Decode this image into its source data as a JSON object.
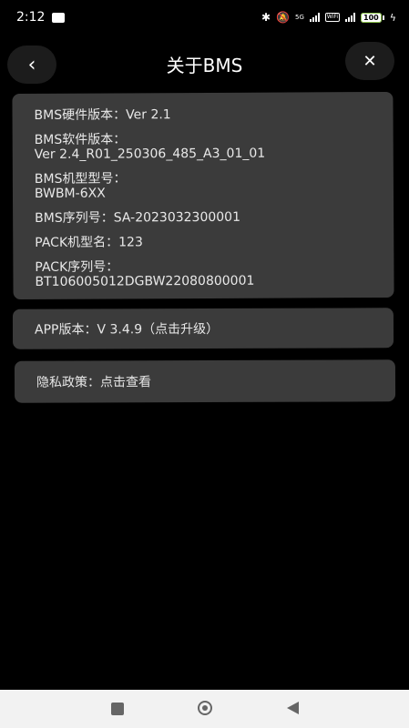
{
  "status_bar": {
    "time": "2:12",
    "net_label": "5G",
    "wifi_label": "WiFi",
    "battery": "100"
  },
  "header": {
    "title": "关于BMS",
    "back_icon": "chevron-left-icon",
    "close_icon": "close-icon"
  },
  "info": {
    "hw_version_label": "BMS硬件版本：",
    "hw_version_value": "Ver 2.1",
    "sw_version_label": "BMS软件版本：",
    "sw_version_value": "Ver 2.4_R01_250306_485_A3_01_01",
    "model_label": "BMS机型型号：",
    "model_value": "BWBM-6XX",
    "serial_label": "BMS序列号：",
    "serial_value": "SA-2023032300001",
    "pack_model_label": "PACK机型名：",
    "pack_model_value": "123",
    "pack_serial_label": "PACK序列号：",
    "pack_serial_value": "BT106005012DGBW22080800001"
  },
  "app": {
    "version_text": "APP版本：V 3.4.9（点击升级）"
  },
  "privacy": {
    "text": "隐私政策：点击查看"
  }
}
